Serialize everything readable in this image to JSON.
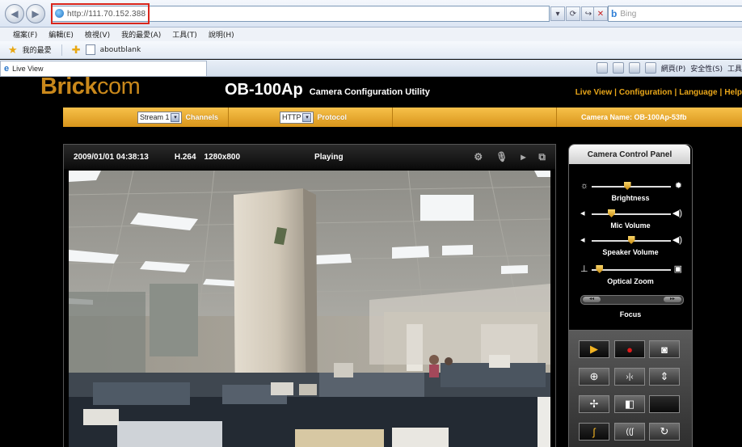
{
  "browser": {
    "url": "http://111.70.152.388",
    "search_placeholder": "Bing",
    "menu": [
      "檔案(F)",
      "編輯(E)",
      "檢視(V)",
      "我的最愛(A)",
      "工具(T)",
      "說明(H)"
    ],
    "favorites_label": "我的最愛",
    "favorite_link": "aboutblank",
    "tab_title": "Live View",
    "command_items": [
      "網頁(P)",
      "安全性(S)",
      "工具"
    ]
  },
  "page": {
    "brand_bold": "Brick",
    "brand_rest": "com",
    "model": "OB-100Ap",
    "utility_title": "Camera Configuration Utility",
    "links": [
      "Live View",
      "Configuration",
      "Language",
      "Help"
    ],
    "stream_value": "Stream 1",
    "channels_label": "Channels",
    "protocol_value": "HTTP",
    "protocol_label": "Protocol",
    "camera_name": "Camera Name: OB-100Ap-53fb"
  },
  "video": {
    "timestamp": "2009/01/01 04:38:13",
    "codec": "H.264",
    "resolution": "1280x800",
    "status": "Playing"
  },
  "control_panel": {
    "title": "Camera Control Panel",
    "brightness_label": "Brightness",
    "brightness_level": 0.45,
    "mic_label": "Mic Volume",
    "mic_level": 0.25,
    "speaker_label": "Speaker Volume",
    "speaker_level": 0.5,
    "zoom_label": "Optical Zoom",
    "zoom_level": 0.1,
    "focus_label": "Focus"
  },
  "colors": {
    "brand_gold": "#c9881b",
    "bar_gold": "#e9a619",
    "url_highlight": "#d9261c"
  }
}
